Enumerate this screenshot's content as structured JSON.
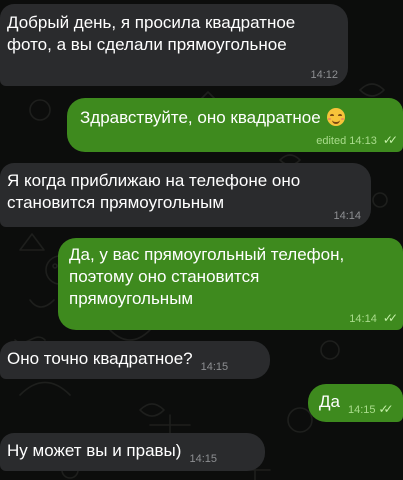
{
  "messages": [
    {
      "dir": "in",
      "lines": [
        "Добрый день, я просила квадратное",
        "фото, а вы сделали прямоугольное"
      ],
      "time": "14:12"
    },
    {
      "dir": "out",
      "lines": [
        "Здравствуйте, оно квадратное"
      ],
      "emoji": "smiling-face-emoji",
      "edited": "edited",
      "time": "14:13"
    },
    {
      "dir": "in",
      "lines": [
        "Я когда приближаю на телефоне оно",
        "становится прямоугольным"
      ],
      "time": "14:14"
    },
    {
      "dir": "out",
      "lines": [
        "Да, у вас прямоугольный телефон,",
        "поэтому оно становится",
        "прямоугольным"
      ],
      "time": "14:14"
    },
    {
      "dir": "in",
      "lines": [
        "Оно точно квадратное?"
      ],
      "time": "14:15"
    },
    {
      "dir": "out",
      "lines": [
        "Да"
      ],
      "time": "14:15"
    },
    {
      "dir": "in",
      "lines": [
        "Ну может вы и правы)"
      ],
      "time": "14:15"
    }
  ],
  "icons": {
    "read_status": "double-check-icon"
  },
  "colors": {
    "background": "#0c0d0c",
    "incoming_bubble": "#2a2b2d",
    "outgoing_bubble": "#3e8a1e",
    "text": "#ffffff"
  }
}
